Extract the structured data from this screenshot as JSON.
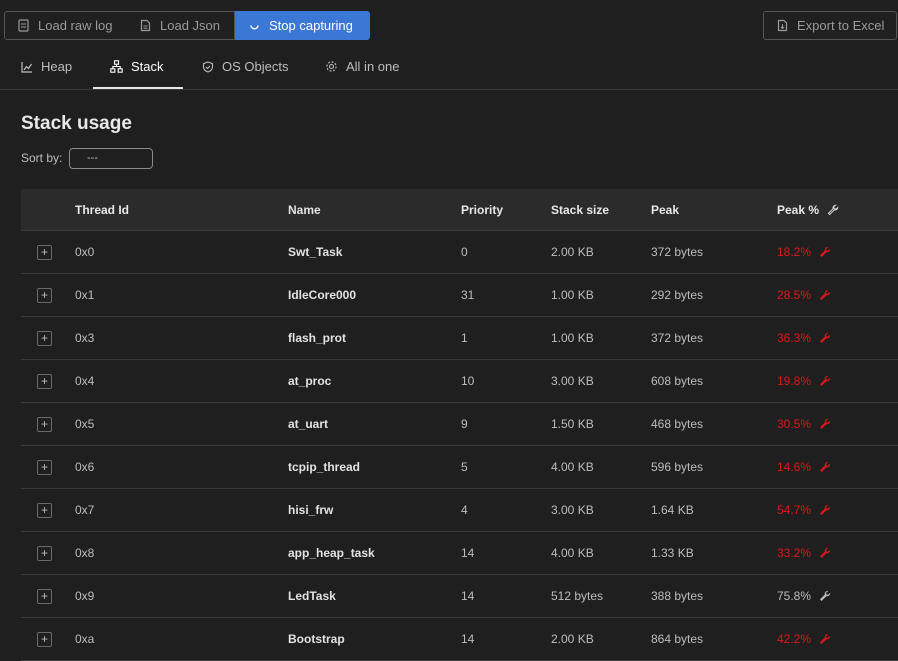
{
  "toolbar": {
    "load_raw_log": "Load raw log",
    "load_json": "Load Json",
    "stop_capturing": "Stop capturing",
    "export_excel": "Export to Excel"
  },
  "tabs": [
    {
      "label": "Heap",
      "icon": "chart-icon"
    },
    {
      "label": "Stack",
      "icon": "hierarchy-icon"
    },
    {
      "label": "OS Objects",
      "icon": "shield-icon"
    },
    {
      "label": "All in one",
      "icon": "gear-icon"
    }
  ],
  "active_tab": "Stack",
  "page_title": "Stack usage",
  "sort": {
    "label": "Sort by:",
    "value": "---"
  },
  "table": {
    "headers": [
      "Thread Id",
      "Name",
      "Priority",
      "Stack size",
      "Peak",
      "Peak %"
    ],
    "rows": [
      {
        "expand": "+",
        "tid": "0x0",
        "name": "Swt_Task",
        "priority": "0",
        "size": "2.00 KB",
        "peak": "372 bytes",
        "pct": "18.2%",
        "high": true
      },
      {
        "expand": "+",
        "tid": "0x1",
        "name": "IdleCore000",
        "priority": "31",
        "size": "1.00 KB",
        "peak": "292 bytes",
        "pct": "28.5%",
        "high": true
      },
      {
        "expand": "+",
        "tid": "0x3",
        "name": "flash_prot",
        "priority": "1",
        "size": "1.00 KB",
        "peak": "372 bytes",
        "pct": "36.3%",
        "high": true
      },
      {
        "expand": "+",
        "tid": "0x4",
        "name": "at_proc",
        "priority": "10",
        "size": "3.00 KB",
        "peak": "608 bytes",
        "pct": "19.8%",
        "high": true
      },
      {
        "expand": "+",
        "tid": "0x5",
        "name": "at_uart",
        "priority": "9",
        "size": "1.50 KB",
        "peak": "468 bytes",
        "pct": "30.5%",
        "high": true
      },
      {
        "expand": "+",
        "tid": "0x6",
        "name": "tcpip_thread",
        "priority": "5",
        "size": "4.00 KB",
        "peak": "596 bytes",
        "pct": "14.6%",
        "high": true
      },
      {
        "expand": "+",
        "tid": "0x7",
        "name": "hisi_frw",
        "priority": "4",
        "size": "3.00 KB",
        "peak": "1.64 KB",
        "pct": "54.7%",
        "high": true
      },
      {
        "expand": "+",
        "tid": "0x8",
        "name": "app_heap_task",
        "priority": "14",
        "size": "4.00 KB",
        "peak": "1.33 KB",
        "pct": "33.2%",
        "high": true
      },
      {
        "expand": "+",
        "tid": "0x9",
        "name": "LedTask",
        "priority": "14",
        "size": "512 bytes",
        "peak": "388 bytes",
        "pct": "75.8%",
        "high": false
      },
      {
        "expand": "+",
        "tid": "0xa",
        "name": "Bootstrap",
        "priority": "14",
        "size": "2.00 KB",
        "peak": "864 bytes",
        "pct": "42.2%",
        "high": true
      }
    ]
  },
  "colors": {
    "accent": "#3b78d6",
    "alert": "#e0161b",
    "text": "#bdbdbd",
    "background": "#1f1f1f",
    "header_bg": "#2b2b2b"
  }
}
